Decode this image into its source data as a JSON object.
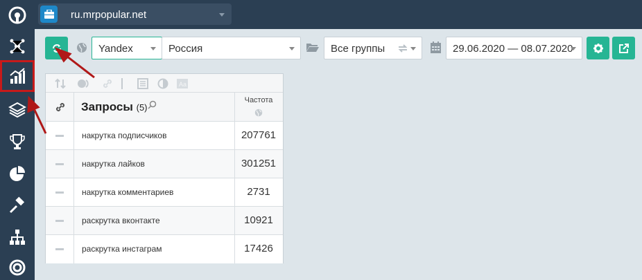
{
  "header": {
    "project_name": "ru.mrpopular.net"
  },
  "toolbar": {
    "search_engine": "Yandex",
    "region": "Россия",
    "groups": "Все группы",
    "date_range": "29.06.2020 — 08.07.2020"
  },
  "table": {
    "title": "Запросы",
    "count": "(5)",
    "freq_label": "Частота",
    "rows": [
      {
        "query": "накрутка подписчиков",
        "freq": "207761"
      },
      {
        "query": "накрутка лайков",
        "freq": "301251"
      },
      {
        "query": "накрутка комментариев",
        "freq": "2731"
      },
      {
        "query": "раскрутка вконтакте",
        "freq": "10921"
      },
      {
        "query": "раскрутка инстаграм",
        "freq": "17426"
      }
    ]
  },
  "colors": {
    "sidebar": "#2b3f53",
    "accent": "#26b594",
    "highlight": "#c81a1a",
    "background": "#dde5ea"
  }
}
